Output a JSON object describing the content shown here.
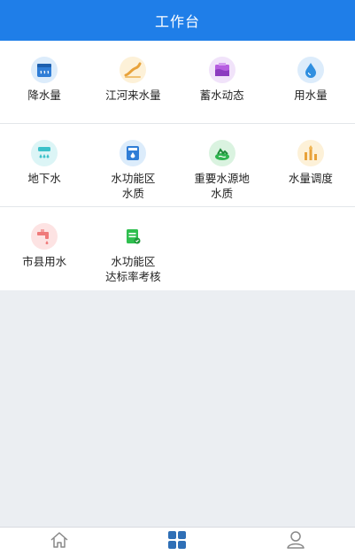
{
  "header": {
    "title": "工作台"
  },
  "rows": [
    [
      {
        "label": "降水量",
        "icon": "rain-gauge-icon",
        "color": "#2f7dd6",
        "bg": "#dcecfb"
      },
      {
        "label": "江河来水量",
        "icon": "river-icon",
        "color": "#e8a23a",
        "bg": "#fdf1d8"
      },
      {
        "label": "蓄水动态",
        "icon": "reservoir-icon",
        "color": "#b65ee0",
        "bg": "#f1e3fa"
      },
      {
        "label": "用水量",
        "icon": "water-drop-icon",
        "color": "#2f8fe0",
        "bg": "#dcecfb"
      }
    ],
    [
      {
        "label": "地下水",
        "icon": "groundwater-icon",
        "color": "#3cc1c9",
        "bg": "#dcf5f6"
      },
      {
        "label": "水功能区\n水质",
        "icon": "water-quality-icon",
        "color": "#2f7dd6",
        "bg": "#dcecfb"
      },
      {
        "label": "重要水源地\n水质",
        "icon": "water-source-icon",
        "color": "#2fb44f",
        "bg": "#daf3e0"
      },
      {
        "label": "水量调度",
        "icon": "dispatch-icon",
        "color": "#e8a23a",
        "bg": "#fdf1d8"
      }
    ],
    [
      {
        "label": "市县用水",
        "icon": "faucet-icon",
        "color": "#ef7a7a",
        "bg": "#fde3e3"
      },
      {
        "label": "水功能区\n达标率考核",
        "icon": "assessment-icon",
        "color": "#2fbf4f",
        "bg": "#ffffff"
      }
    ]
  ],
  "tabbar": {
    "items": [
      {
        "icon": "home-icon",
        "active": false
      },
      {
        "icon": "grid-icon",
        "active": true
      },
      {
        "icon": "user-icon",
        "active": false
      }
    ],
    "active_color": "#2f6fb6",
    "inactive_color": "#888888"
  }
}
